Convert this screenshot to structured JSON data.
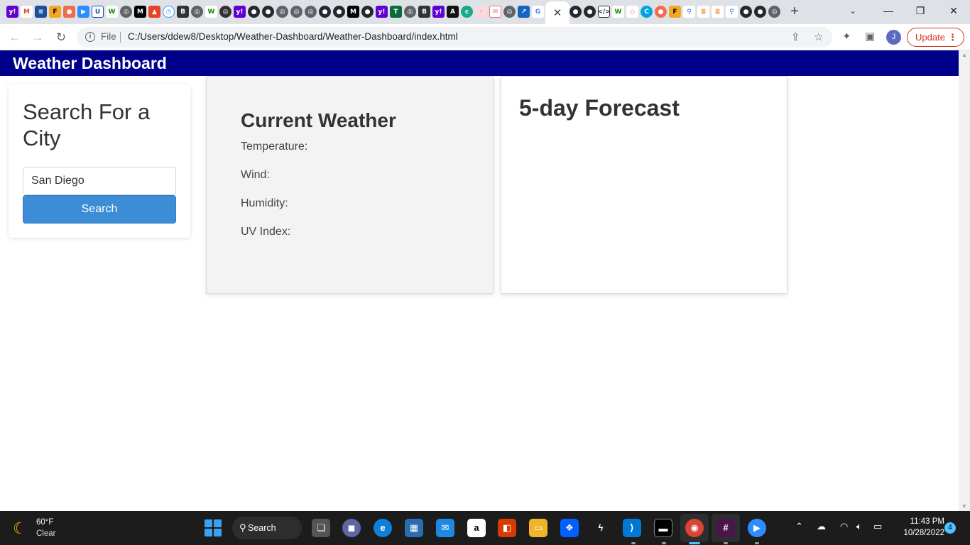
{
  "browser": {
    "active_tab_close": "✕",
    "new_tab": "+",
    "address": {
      "scheme": "File",
      "url": "C:/Users/ddew8/Desktop/Weather-Dashboard/Weather-Dashboard/index.html"
    },
    "profile_initial": "J",
    "update_label": "Update",
    "colors": {
      "update": "#d93025",
      "tabstrip": "#dee1e6"
    }
  },
  "app": {
    "title": "Weather Dashboard",
    "header_color": "#00008b",
    "search": {
      "heading": "Search For a City",
      "input_value": "San Diego",
      "button_label": "Search",
      "button_color": "#3c8dd5"
    },
    "current": {
      "heading": "Current Weather",
      "temperature_label": "Temperature:",
      "wind_label": "Wind:",
      "humidity_label": "Humidity:",
      "uv_label": "UV Index:"
    },
    "forecast": {
      "heading": "5-day Forecast"
    }
  },
  "taskbar": {
    "weather_temp": "60°F",
    "weather_condition": "Clear",
    "search_label": "Search",
    "amazon_letter": "a",
    "clock_time": "11:43 PM",
    "clock_date": "10/28/2022",
    "notification_count": "4"
  }
}
